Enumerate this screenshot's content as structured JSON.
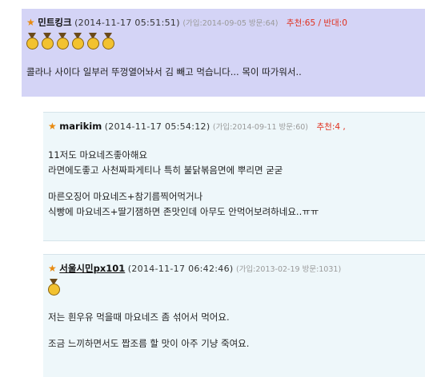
{
  "comments": [
    {
      "nickname": "민트킹크",
      "timestamp": "(2014-11-17 05:51:51)",
      "meta": "(가입:2014-09-05 방문:64)",
      "recommend": "추천:65 / 반대:0",
      "medals": 6,
      "lines": [
        "콜라나 사이다 일부러 뚜껑열어놔서 김 빼고 먹습니다... 목이 따가워서.."
      ]
    },
    {
      "nickname": "marikim",
      "timestamp": "(2014-11-17 05:54:12)",
      "meta": "(가입:2014-09-11 방문:60)",
      "recommend": "추천:4 ,",
      "medals": 0,
      "lines": [
        "11저도 마요네즈좋아해요",
        "라면에도좋고 사천짜파게티나 특히 불닭볶음면에 뿌리면 굳굳",
        "",
        "마른오징어 마요네즈+참기름찍어먹거나",
        "식빵에 마요네즈+딸기잼하면 존맛인데 아무도 안먹어보려하네요..ㅠㅠ"
      ]
    },
    {
      "nickname": "서울시민px101",
      "timestamp": "(2014-11-17 06:42:46)",
      "meta": "(가입:2013-02-19 방문:1031)",
      "recommend": "",
      "medals": 1,
      "lines": [
        "저는 흰우유 먹을때 마요네즈 좀 섞어서 먹어요.",
        "",
        "조금 느끼하면서도 짭조름 할 맛이 아주 기냥 죽여요."
      ]
    }
  ],
  "icons": {
    "rank": "star-icon",
    "medal": "medal-icon"
  },
  "colors": {
    "best_bg": "#d4d4f6",
    "reply_bg": "#eef7fa",
    "recommend": "#e0301e",
    "star": "#e88a0f",
    "meta": "#9a9a9a"
  }
}
